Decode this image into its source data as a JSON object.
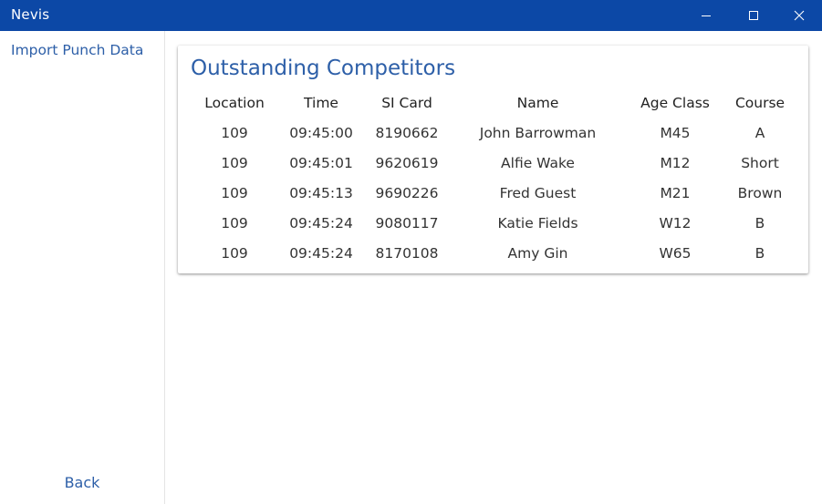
{
  "window": {
    "title": "Nevis",
    "controls": {
      "minimize": "minimize-icon",
      "maximize": "maximize-icon",
      "close": "close-icon"
    },
    "titlebar_color": "#0c48a6"
  },
  "sidebar": {
    "import_label": "Import Punch Data",
    "back_label": "Back"
  },
  "main": {
    "heading": "Outstanding Competitors",
    "accent_color": "#2d5fa8",
    "table": {
      "columns": [
        "Location",
        "Time",
        "SI Card",
        "Name",
        "Age Class",
        "Course"
      ],
      "rows": [
        [
          "109",
          "09:45:00",
          "8190662",
          "John Barrowman",
          "M45",
          "A"
        ],
        [
          "109",
          "09:45:01",
          "9620619",
          "Alfie Wake",
          "M12",
          "Short"
        ],
        [
          "109",
          "09:45:13",
          "9690226",
          "Fred Guest",
          "M21",
          "Brown"
        ],
        [
          "109",
          "09:45:24",
          "9080117",
          "Katie Fields",
          "W12",
          "B"
        ],
        [
          "109",
          "09:45:24",
          "8170108",
          "Amy Gin",
          "W65",
          "B"
        ]
      ]
    }
  }
}
